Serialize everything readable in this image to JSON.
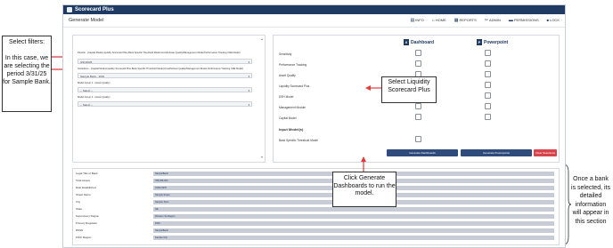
{
  "app": {
    "title": "Scorecard Plus"
  },
  "header": {
    "page_title": "Generate Model"
  },
  "nav": [
    {
      "label": "INFO",
      "icon": "document-icon",
      "glyph": "▤"
    },
    {
      "label": "HOME",
      "icon": "home-icon",
      "glyph": "⌂"
    },
    {
      "label": "REPORTS",
      "icon": "reports-icon",
      "glyph": "▦"
    },
    {
      "label": "ADMIN",
      "icon": "tools-icon",
      "glyph": "✂"
    },
    {
      "label": "PERMISSIONS",
      "icon": "permissions-icon",
      "glyph": "▬"
    },
    {
      "label": "LOCK",
      "icon": "lock-icon",
      "glyph": "🔒"
    }
  ],
  "filters": [
    {
      "label": "Periods - (Capital Model,Liquidity Scorecard Plus,Bank Specific Threshold Model,Growth/Asset Quality/Management Model,Performance Tracking,CRE Model)",
      "value": "3/31/2025"
    },
    {
      "label": "Institutions - (Capital Model,Liquidity Scorecard Plus,Bank Specific Threshold Model,Growth/Asset Quality/Management Model,Performance Tracking,CRE Model)",
      "value": "Sample Bank - 1001"
    },
    {
      "label": "Model Group 1 - (Asset Quality)",
      "value": "-- Select --"
    },
    {
      "label": "Model Group 2 - (Asset Quality)",
      "value": "-- Select --"
    }
  ],
  "columns": {
    "dashboard": "Dashboard",
    "powerpoint": "Powerpoint"
  },
  "models": [
    {
      "label": "Sensitivity",
      "dash": false,
      "ppt": false
    },
    {
      "label": "Performance Tracking",
      "dash": false,
      "ppt": false
    },
    {
      "label": "Asset Quality",
      "dash": false,
      "ppt": false
    },
    {
      "label": "Liquidity Scorecard Plus",
      "dash": true,
      "ppt": false
    },
    {
      "label": "DSH Model",
      "dash": false,
      "ppt": false
    },
    {
      "label": "Management Module",
      "dash": false,
      "ppt": false
    },
    {
      "label": "Capital Model",
      "dash": false,
      "ppt": false
    }
  ],
  "input_models": {
    "heading": "Input Model(s)",
    "item": "Bank Specific Threshold Model"
  },
  "buttons": {
    "gen_dash": "Generate Dashboards",
    "gen_ppt": "Generate Powerpoints",
    "clear": "Clear Selections"
  },
  "info_rows": [
    {
      "label": "Legal Title of Bank",
      "value": "SampleBank"
    },
    {
      "label": "Total Assets",
      "value": "789,456,000"
    },
    {
      "label": "Date Established",
      "value": "01/01/1970"
    },
    {
      "label": "Street Name",
      "value": "Sample Street"
    },
    {
      "label": "City",
      "value": "Sample Town"
    },
    {
      "label": "State",
      "value": "NE"
    },
    {
      "label": "Supervisory Region",
      "value": "Western Sp Region"
    },
    {
      "label": "Primary Regulator",
      "value": "FDIC"
    },
    {
      "label": "RSSD",
      "value": "SampleBank"
    },
    {
      "label": "FDIC Region",
      "value": "Kansas City"
    }
  ],
  "callouts": {
    "filters": "Select filters:\n\nIn this case, we are selecting the period 3/31/25 for Sample Bank.",
    "liquidity": "Select Liquidity Scorecard Plus",
    "generate": "Click Generate Dashboards to run the model.",
    "details": "Once a bank is selected, its detailed information will appear in this section"
  },
  "colors": {
    "navy": "#1f3a63",
    "blue_btn": "#2f4b7c",
    "red_btn": "#d9434b",
    "arrow": "#e23b3b"
  }
}
